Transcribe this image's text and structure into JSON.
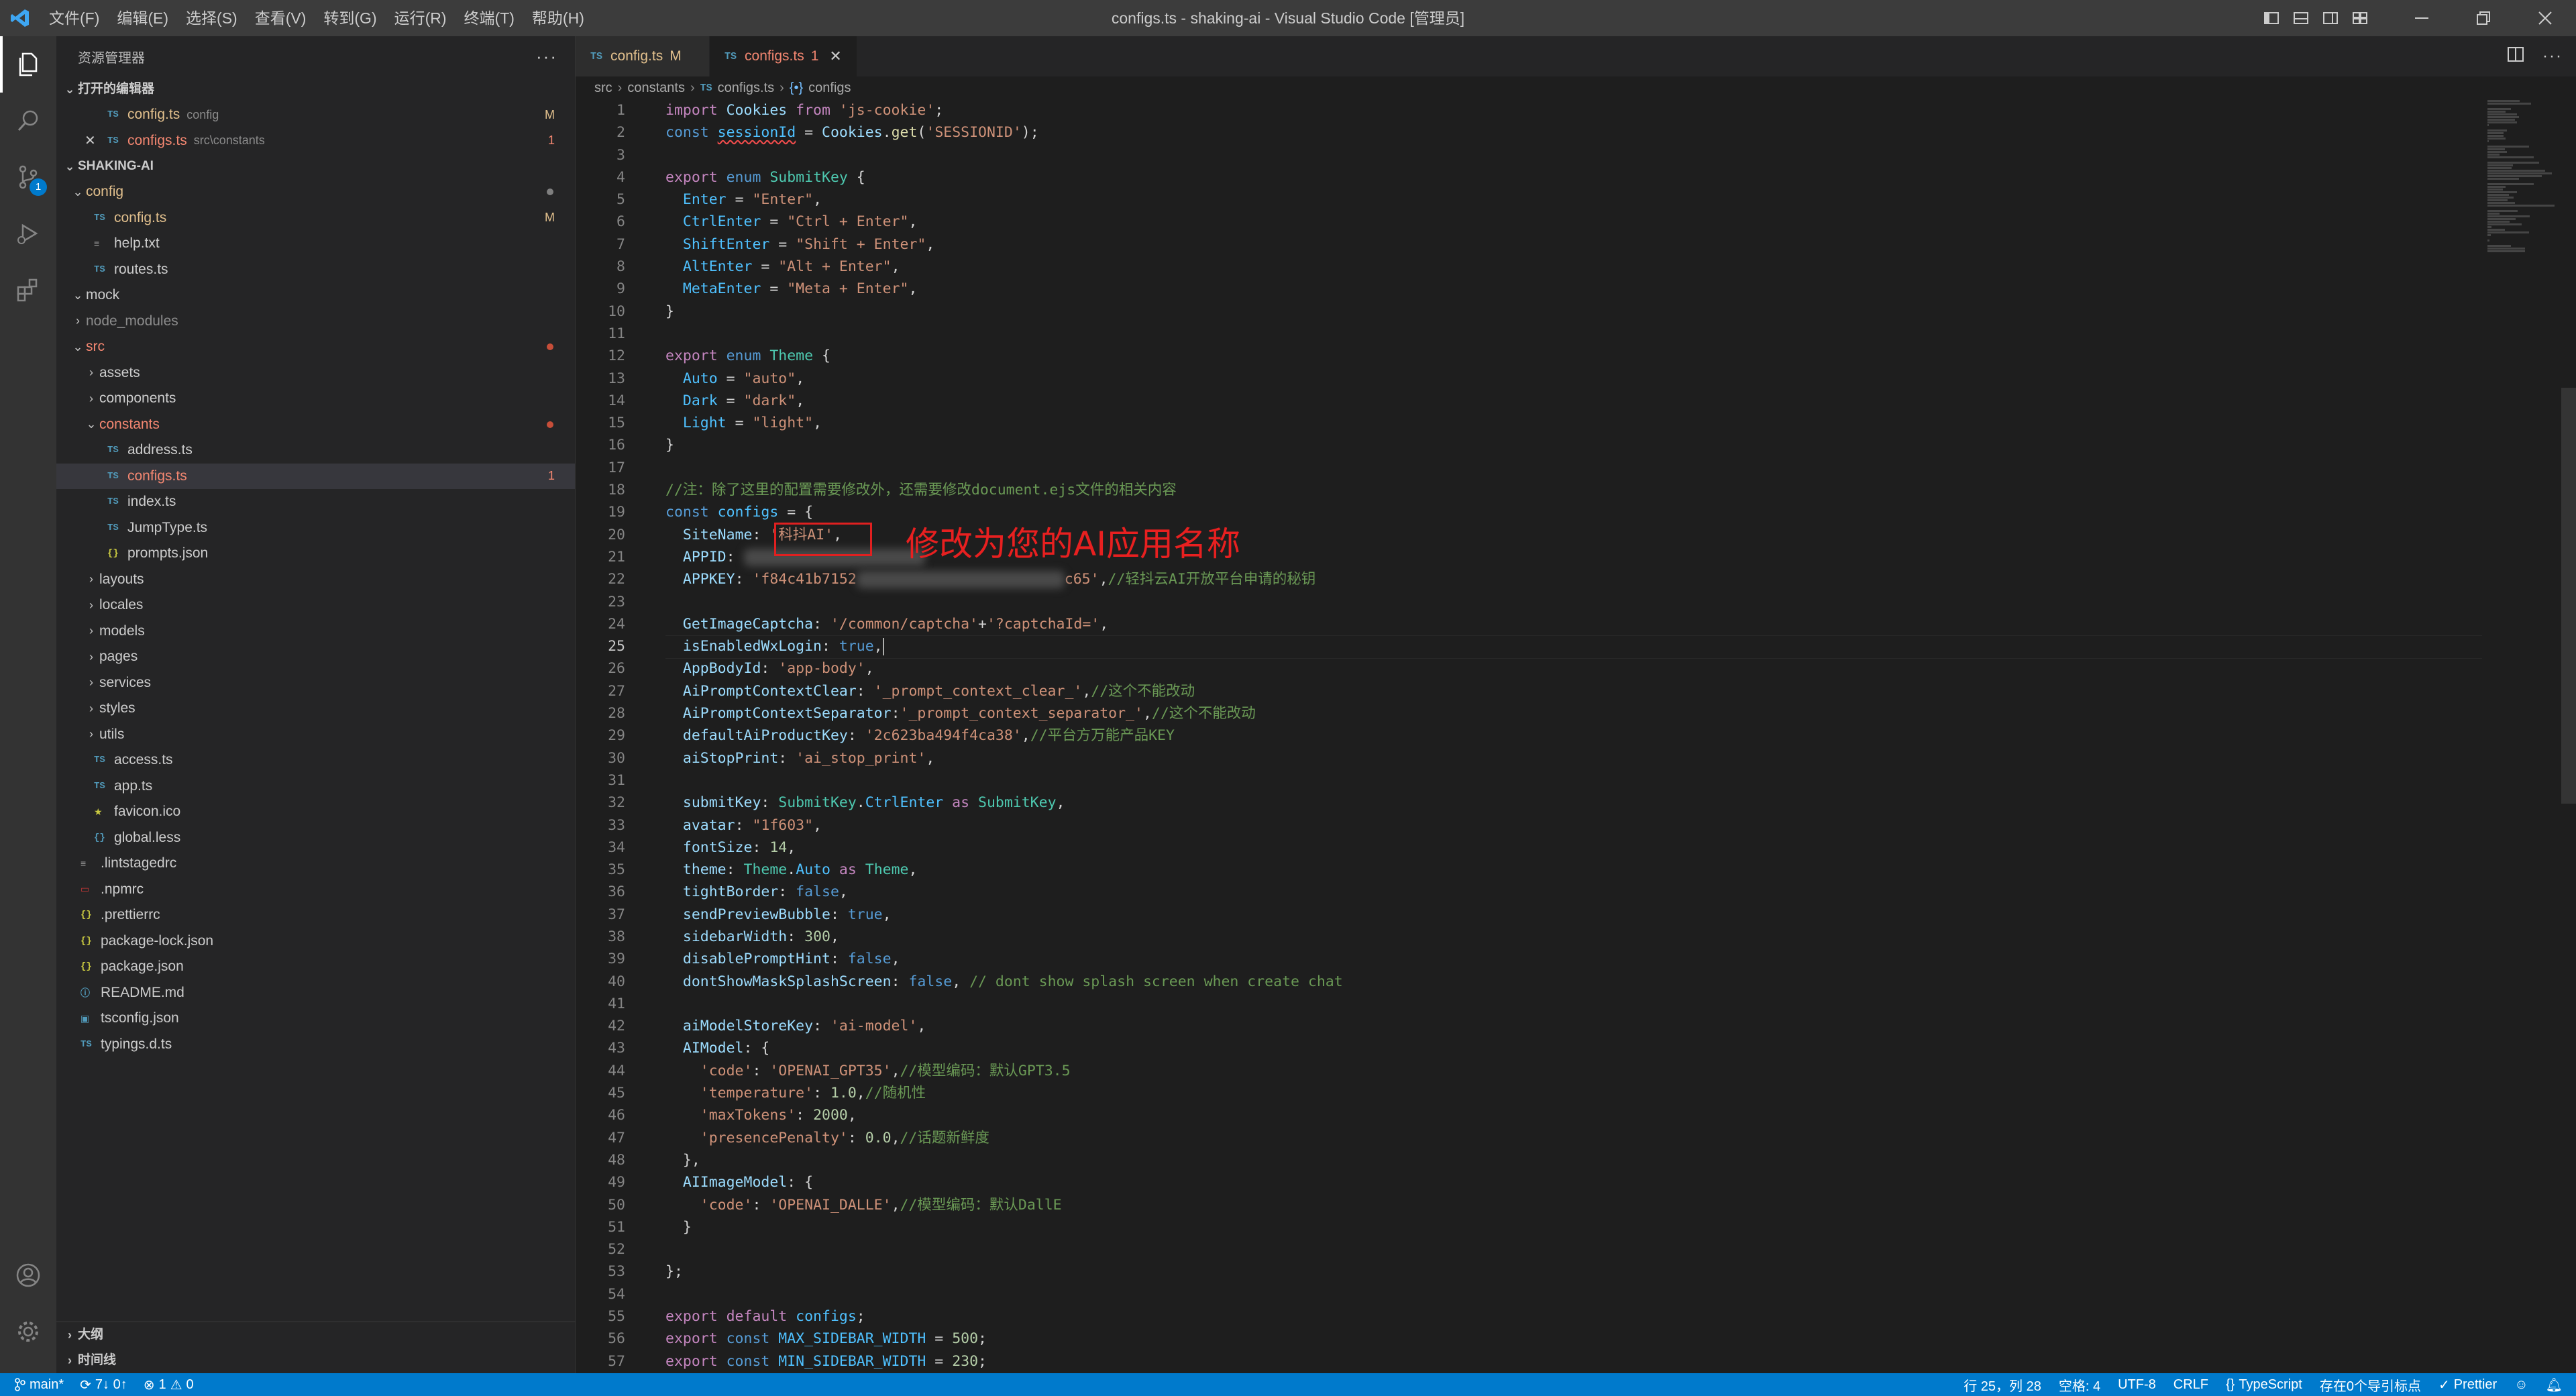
{
  "titlebar": {
    "menu": [
      "文件(F)",
      "编辑(E)",
      "选择(S)",
      "查看(V)",
      "转到(G)",
      "运行(R)",
      "终端(T)",
      "帮助(H)"
    ],
    "title": "configs.ts - shaking-ai - Visual Studio Code [管理员]"
  },
  "activity": {
    "scm_badge": "1"
  },
  "sidebar": {
    "header": "资源管理器",
    "more": "···",
    "open_editors": {
      "title": "打开的编辑器",
      "items": [
        {
          "icon": "TS",
          "name": "config.ts",
          "desc": "config",
          "badge": "M"
        },
        {
          "icon": "TS",
          "name": "configs.ts",
          "desc": "src\\constants",
          "badge": "1"
        }
      ]
    },
    "project": {
      "title": "SHAKING-AI",
      "tree": [
        {
          "depth": 1,
          "type": "folder-open",
          "name": "config",
          "state": "mod-dot"
        },
        {
          "depth": 2,
          "type": "ts",
          "icon": "TS",
          "name": "config.ts",
          "state": "M"
        },
        {
          "depth": 2,
          "type": "txt",
          "icon": "≡",
          "name": "help.txt"
        },
        {
          "depth": 2,
          "type": "ts",
          "icon": "TS",
          "name": "routes.ts"
        },
        {
          "depth": 1,
          "type": "folder-open",
          "name": "mock"
        },
        {
          "depth": 1,
          "type": "folder",
          "name": "node_modules",
          "state": "dim"
        },
        {
          "depth": 1,
          "type": "folder-open",
          "name": "src",
          "state": "err-dot"
        },
        {
          "depth": 2,
          "type": "folder",
          "name": "assets"
        },
        {
          "depth": 2,
          "type": "folder",
          "name": "components"
        },
        {
          "depth": 2,
          "type": "folder-open",
          "name": "constants",
          "state": "err-dot"
        },
        {
          "depth": 3,
          "type": "ts",
          "icon": "TS",
          "name": "address.ts"
        },
        {
          "depth": 3,
          "type": "ts",
          "icon": "TS",
          "name": "configs.ts",
          "state": "1",
          "selected": true
        },
        {
          "depth": 3,
          "type": "ts",
          "icon": "TS",
          "name": "index.ts"
        },
        {
          "depth": 3,
          "type": "ts",
          "icon": "TS",
          "name": "JumpType.ts"
        },
        {
          "depth": 3,
          "type": "json",
          "icon": "{}",
          "name": "prompts.json"
        },
        {
          "depth": 2,
          "type": "folder",
          "name": "layouts"
        },
        {
          "depth": 2,
          "type": "folder",
          "name": "locales"
        },
        {
          "depth": 2,
          "type": "folder",
          "name": "models"
        },
        {
          "depth": 2,
          "type": "folder",
          "name": "pages"
        },
        {
          "depth": 2,
          "type": "folder",
          "name": "services"
        },
        {
          "depth": 2,
          "type": "folder",
          "name": "styles"
        },
        {
          "depth": 2,
          "type": "folder",
          "name": "utils"
        },
        {
          "depth": 2,
          "type": "ts",
          "icon": "TS",
          "name": "access.ts"
        },
        {
          "depth": 2,
          "type": "ts",
          "icon": "TS",
          "name": "app.ts"
        },
        {
          "depth": 2,
          "type": "star",
          "icon": "★",
          "name": "favicon.ico"
        },
        {
          "depth": 2,
          "type": "less",
          "icon": "{}",
          "name": "global.less"
        },
        {
          "depth": 1,
          "type": "txt",
          "icon": "≡",
          "name": ".lintstagedrc"
        },
        {
          "depth": 1,
          "type": "npm",
          "icon": "▭",
          "name": ".npmrc"
        },
        {
          "depth": 1,
          "type": "json",
          "icon": "{}",
          "name": ".prettierrc"
        },
        {
          "depth": 1,
          "type": "json",
          "icon": "{}",
          "name": "package-lock.json"
        },
        {
          "depth": 1,
          "type": "json",
          "icon": "{}",
          "name": "package.json"
        },
        {
          "depth": 1,
          "type": "info",
          "icon": "ⓘ",
          "name": "README.md"
        },
        {
          "depth": 1,
          "type": "tsconfig",
          "icon": "▣",
          "name": "tsconfig.json"
        },
        {
          "depth": 1,
          "type": "ts",
          "icon": "TS",
          "name": "typings.d.ts"
        }
      ]
    },
    "outline": "大纲",
    "timeline": "时间线"
  },
  "editor": {
    "tabs": [
      {
        "icon": "TS",
        "name": "config.ts",
        "state": "M",
        "active": false
      },
      {
        "icon": "TS",
        "name": "configs.ts",
        "state": "1",
        "active": true
      }
    ],
    "breadcrumbs": [
      "src",
      "constants",
      "configs.ts",
      "configs"
    ],
    "breadcrumb_icons": [
      "",
      "",
      "TS",
      "{•}"
    ],
    "current_line": 25,
    "annotation": "修改为您的AI应用名称",
    "lines": [
      [
        [
          "kw2",
          "import "
        ],
        [
          "var",
          "Cookies"
        ],
        [
          "kw2",
          " from "
        ],
        [
          "str",
          "'js-cookie'"
        ],
        [
          "",
          ";"
        ]
      ],
      [
        [
          "kw",
          "const "
        ],
        [
          "cst squig",
          "sessionId"
        ],
        [
          "",
          " = "
        ],
        [
          "var",
          "Cookies"
        ],
        [
          "",
          "."
        ],
        [
          "fn",
          "get"
        ],
        [
          "",
          "("
        ],
        [
          "str",
          "'SESSIONID'"
        ],
        [
          "",
          ");"
        ]
      ],
      [],
      [
        [
          "kw2",
          "export "
        ],
        [
          "kw",
          "enum "
        ],
        [
          "typ",
          "SubmitKey"
        ],
        [
          "",
          " {"
        ]
      ],
      [
        [
          "",
          "  "
        ],
        [
          "cst",
          "Enter"
        ],
        [
          "",
          " = "
        ],
        [
          "str",
          "\"Enter\""
        ],
        [
          "",
          ","
        ]
      ],
      [
        [
          "",
          "  "
        ],
        [
          "cst",
          "CtrlEnter"
        ],
        [
          "",
          " = "
        ],
        [
          "str",
          "\"Ctrl + Enter\""
        ],
        [
          "",
          ","
        ]
      ],
      [
        [
          "",
          "  "
        ],
        [
          "cst",
          "ShiftEnter"
        ],
        [
          "",
          " = "
        ],
        [
          "str",
          "\"Shift + Enter\""
        ],
        [
          "",
          ","
        ]
      ],
      [
        [
          "",
          "  "
        ],
        [
          "cst",
          "AltEnter"
        ],
        [
          "",
          " = "
        ],
        [
          "str",
          "\"Alt + Enter\""
        ],
        [
          "",
          ","
        ]
      ],
      [
        [
          "",
          "  "
        ],
        [
          "cst",
          "MetaEnter"
        ],
        [
          "",
          " = "
        ],
        [
          "str",
          "\"Meta + Enter\""
        ],
        [
          "",
          ","
        ]
      ],
      [
        [
          "",
          "}"
        ]
      ],
      [],
      [
        [
          "kw2",
          "export "
        ],
        [
          "kw",
          "enum "
        ],
        [
          "typ",
          "Theme"
        ],
        [
          "",
          " {"
        ]
      ],
      [
        [
          "",
          "  "
        ],
        [
          "cst",
          "Auto"
        ],
        [
          "",
          " = "
        ],
        [
          "str",
          "\"auto\""
        ],
        [
          "",
          ","
        ]
      ],
      [
        [
          "",
          "  "
        ],
        [
          "cst",
          "Dark"
        ],
        [
          "",
          " = "
        ],
        [
          "str",
          "\"dark\""
        ],
        [
          "",
          ","
        ]
      ],
      [
        [
          "",
          "  "
        ],
        [
          "cst",
          "Light"
        ],
        [
          "",
          " = "
        ],
        [
          "str",
          "\"light\""
        ],
        [
          "",
          ","
        ]
      ],
      [
        [
          "",
          "}"
        ]
      ],
      [],
      [
        [
          "cmt",
          "//注：除了这里的配置需要修改外，还需要修改document.ejs文件的相关内容"
        ]
      ],
      [
        [
          "kw",
          "const "
        ],
        [
          "cst",
          "configs"
        ],
        [
          "",
          " = {"
        ]
      ],
      [
        [
          "",
          "  "
        ],
        [
          "var",
          "SiteName"
        ],
        [
          "",
          ": "
        ],
        [
          "str",
          "'科抖AI'"
        ],
        [
          "",
          ","
        ]
      ],
      [
        [
          "",
          "  "
        ],
        [
          "var",
          "APPID"
        ],
        [
          "",
          ": "
        ],
        [
          "blur",
          "270"
        ]
      ],
      [
        [
          "",
          "  "
        ],
        [
          "var",
          "APPKEY"
        ],
        [
          "",
          ": "
        ],
        [
          "str",
          "'f84c41b7152"
        ],
        [
          "blur",
          "310"
        ],
        [
          "str",
          "c65'"
        ],
        [
          "",
          ","
        ],
        [
          "cmt",
          "//轻抖云AI开放平台申请的秘钥"
        ]
      ],
      [],
      [
        [
          "",
          "  "
        ],
        [
          "var",
          "GetImageCaptcha"
        ],
        [
          "",
          ": "
        ],
        [
          "str",
          "'/common/captcha'"
        ],
        [
          "",
          "+"
        ],
        [
          "str",
          "'?captchaId='"
        ],
        [
          "",
          ","
        ]
      ],
      [
        [
          "",
          "  "
        ],
        [
          "var",
          "isEnabledWxLogin"
        ],
        [
          "",
          ": "
        ],
        [
          "kw",
          "true"
        ],
        [
          "",
          ","
        ],
        [
          "caret",
          ""
        ]
      ],
      [
        [
          "",
          "  "
        ],
        [
          "var",
          "AppBodyId"
        ],
        [
          "",
          ": "
        ],
        [
          "str",
          "'app-body'"
        ],
        [
          "",
          ","
        ]
      ],
      [
        [
          "",
          "  "
        ],
        [
          "var",
          "AiPromptContextClear"
        ],
        [
          "",
          ": "
        ],
        [
          "str",
          "'_prompt_context_clear_'"
        ],
        [
          "",
          ","
        ],
        [
          "cmt",
          "//这个不能改动"
        ]
      ],
      [
        [
          "",
          "  "
        ],
        [
          "var",
          "AiPromptContextSeparator"
        ],
        [
          "",
          ":"
        ],
        [
          "str",
          "'_prompt_context_separator_'"
        ],
        [
          "",
          ","
        ],
        [
          "cmt",
          "//这个不能改动"
        ]
      ],
      [
        [
          "",
          "  "
        ],
        [
          "var",
          "defaultAiProductKey"
        ],
        [
          "",
          ": "
        ],
        [
          "str",
          "'2c623ba494f4ca38'"
        ],
        [
          "",
          ","
        ],
        [
          "cmt",
          "//平台方万能产品KEY"
        ]
      ],
      [
        [
          "",
          "  "
        ],
        [
          "var",
          "aiStopPrint"
        ],
        [
          "",
          ": "
        ],
        [
          "str",
          "'ai_stop_print'"
        ],
        [
          "",
          ","
        ]
      ],
      [],
      [
        [
          "",
          "  "
        ],
        [
          "var",
          "submitKey"
        ],
        [
          "",
          ": "
        ],
        [
          "typ",
          "SubmitKey"
        ],
        [
          "",
          "."
        ],
        [
          "cst",
          "CtrlEnter"
        ],
        [
          "kw2",
          " as "
        ],
        [
          "typ",
          "SubmitKey"
        ],
        [
          "",
          ","
        ]
      ],
      [
        [
          "",
          "  "
        ],
        [
          "var",
          "avatar"
        ],
        [
          "",
          ": "
        ],
        [
          "str",
          "\"1f603\""
        ],
        [
          "",
          ","
        ]
      ],
      [
        [
          "",
          "  "
        ],
        [
          "var",
          "fontSize"
        ],
        [
          "",
          ": "
        ],
        [
          "num",
          "14"
        ],
        [
          "",
          ","
        ]
      ],
      [
        [
          "",
          "  "
        ],
        [
          "var",
          "theme"
        ],
        [
          "",
          ": "
        ],
        [
          "typ",
          "Theme"
        ],
        [
          "",
          "."
        ],
        [
          "cst",
          "Auto"
        ],
        [
          "kw2",
          " as "
        ],
        [
          "typ",
          "Theme"
        ],
        [
          "",
          ","
        ]
      ],
      [
        [
          "",
          "  "
        ],
        [
          "var",
          "tightBorder"
        ],
        [
          "",
          ": "
        ],
        [
          "kw",
          "false"
        ],
        [
          "",
          ","
        ]
      ],
      [
        [
          "",
          "  "
        ],
        [
          "var",
          "sendPreviewBubble"
        ],
        [
          "",
          ": "
        ],
        [
          "kw",
          "true"
        ],
        [
          "",
          ","
        ]
      ],
      [
        [
          "",
          "  "
        ],
        [
          "var",
          "sidebarWidth"
        ],
        [
          "",
          ": "
        ],
        [
          "num",
          "300"
        ],
        [
          "",
          ","
        ]
      ],
      [
        [
          "",
          "  "
        ],
        [
          "var",
          "disablePromptHint"
        ],
        [
          "",
          ": "
        ],
        [
          "kw",
          "false"
        ],
        [
          "",
          ","
        ]
      ],
      [
        [
          "",
          "  "
        ],
        [
          "var",
          "dontShowMaskSplashScreen"
        ],
        [
          "",
          ": "
        ],
        [
          "kw",
          "false"
        ],
        [
          "",
          ", "
        ],
        [
          "cmt",
          "// dont show splash screen when create chat"
        ]
      ],
      [],
      [
        [
          "",
          "  "
        ],
        [
          "var",
          "aiModelStoreKey"
        ],
        [
          "",
          ": "
        ],
        [
          "str",
          "'ai-model'"
        ],
        [
          "",
          ","
        ]
      ],
      [
        [
          "",
          "  "
        ],
        [
          "var",
          "AIModel"
        ],
        [
          "",
          ": {"
        ]
      ],
      [
        [
          "",
          "    "
        ],
        [
          "str",
          "'code'"
        ],
        [
          "",
          ": "
        ],
        [
          "str",
          "'OPENAI_GPT35'"
        ],
        [
          "",
          ","
        ],
        [
          "cmt",
          "//模型编码：默认GPT3.5"
        ]
      ],
      [
        [
          "",
          "    "
        ],
        [
          "str",
          "'temperature'"
        ],
        [
          "",
          ": "
        ],
        [
          "num",
          "1.0"
        ],
        [
          "",
          ","
        ],
        [
          "cmt",
          "//随机性"
        ]
      ],
      [
        [
          "",
          "    "
        ],
        [
          "str",
          "'maxTokens'"
        ],
        [
          "",
          ": "
        ],
        [
          "num",
          "2000"
        ],
        [
          "",
          ","
        ]
      ],
      [
        [
          "",
          "    "
        ],
        [
          "str",
          "'presencePenalty'"
        ],
        [
          "",
          ": "
        ],
        [
          "num",
          "0.0"
        ],
        [
          "",
          ","
        ],
        [
          "cmt",
          "//话题新鲜度"
        ]
      ],
      [
        [
          "",
          "  },"
        ]
      ],
      [
        [
          "",
          "  "
        ],
        [
          "var",
          "AIImageModel"
        ],
        [
          "",
          ": {"
        ]
      ],
      [
        [
          "",
          "    "
        ],
        [
          "str",
          "'code'"
        ],
        [
          "",
          ": "
        ],
        [
          "str",
          "'OPENAI_DALLE'"
        ],
        [
          "",
          ","
        ],
        [
          "cmt",
          "//模型编码：默认DallE"
        ]
      ],
      [
        [
          "",
          "  }"
        ]
      ],
      [],
      [
        [
          "",
          "};"
        ]
      ],
      [],
      [
        [
          "kw2",
          "export "
        ],
        [
          "kw2",
          "default "
        ],
        [
          "cst",
          "configs"
        ],
        [
          "",
          ";"
        ]
      ],
      [
        [
          "kw2",
          "export "
        ],
        [
          "kw",
          "const "
        ],
        [
          "cst",
          "MAX_SIDEBAR_WIDTH"
        ],
        [
          "",
          " = "
        ],
        [
          "num",
          "500"
        ],
        [
          "",
          ";"
        ]
      ],
      [
        [
          "kw2",
          "export "
        ],
        [
          "kw",
          "const "
        ],
        [
          "cst",
          "MIN_SIDEBAR_WIDTH"
        ],
        [
          "",
          " = "
        ],
        [
          "num",
          "230"
        ],
        [
          "",
          ";"
        ]
      ]
    ]
  },
  "statusbar": {
    "branch": "main*",
    "sync": "7↓ 0↑",
    "problems_errors": "1",
    "problems_warnings": "0",
    "position": "行 25，列 28",
    "spaces": "空格: 4",
    "encoding": "UTF-8",
    "eol": "CRLF",
    "language": "TypeScript",
    "unsaved": "存在0个导引标点",
    "prettier": "Prettier"
  }
}
